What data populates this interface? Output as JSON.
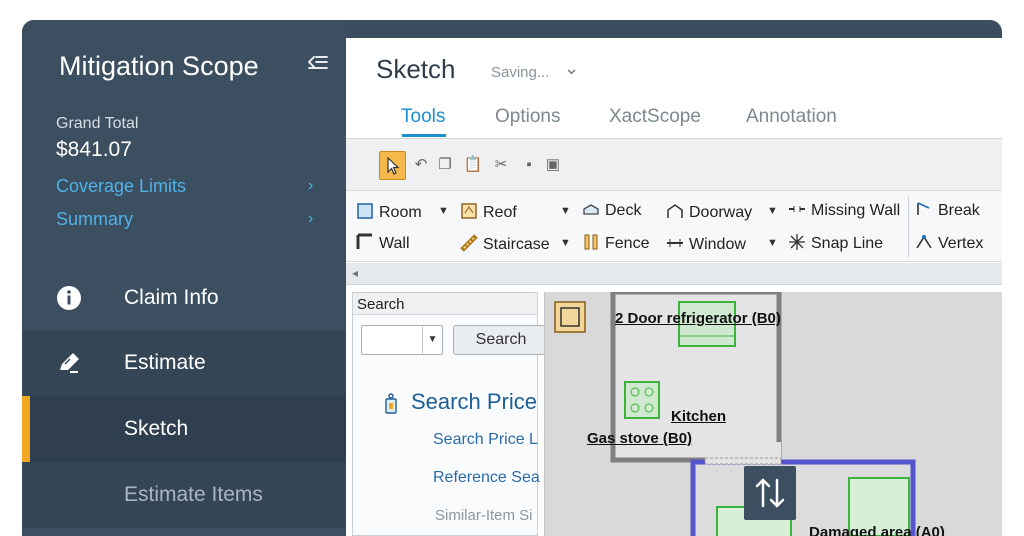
{
  "sidebar": {
    "title": "Mitigation Scope",
    "grand_total_label": "Grand Total",
    "grand_total_value": "$841.07",
    "links": [
      "Coverage Limits",
      "Summary"
    ],
    "nav": {
      "claim_info": "Claim Info",
      "estimate": "Estimate",
      "sketch": "Sketch",
      "estimate_items": "Estimate Items"
    },
    "accent_color": "#f2a922",
    "link_color": "#4fb2e6"
  },
  "main": {
    "title": "Sketch",
    "status": "Saving...",
    "tabs": [
      "Tools",
      "Options",
      "XactScope",
      "Annotation"
    ],
    "active_tab": "Tools"
  },
  "toolbar": {
    "icons": [
      "select-arrow-icon",
      "undo-icon",
      "copy-icon",
      "paste-icon",
      "cut-icon",
      "stamp-icon",
      "paint-icon"
    ]
  },
  "ribbon": {
    "items": [
      "Room",
      "Reof",
      "Deck",
      "Doorway",
      "Missing Wall",
      "Break",
      "Wall",
      "Staircase",
      "Fence",
      "Window",
      "Snap Line",
      "Vertex"
    ]
  },
  "search_panel": {
    "header": "Search",
    "button": "Search",
    "heading": "Search Price",
    "links": [
      "Search Price L",
      "Reference Sea",
      "Similar-Item Si"
    ]
  },
  "canvas": {
    "labels": [
      "2 Door refrigerator (B0)",
      "Kitchen",
      "Gas stove (B0)",
      "Damaged area (A0)"
    ]
  }
}
